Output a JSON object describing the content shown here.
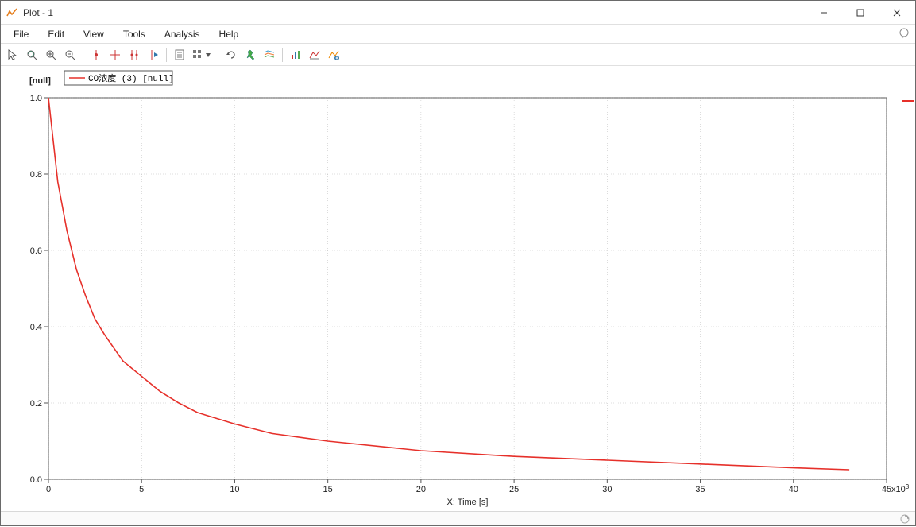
{
  "window": {
    "title": "Plot - 1"
  },
  "menu": {
    "items": [
      "File",
      "Edit",
      "View",
      "Tools",
      "Analysis",
      "Help"
    ]
  },
  "toolbar": {
    "buttons": [
      "arrow-cursor",
      "reset-zoom",
      "zoom-in",
      "zoom-out",
      "|",
      "single-marker",
      "cross-marker",
      "dual-marker",
      "play-marker",
      "|",
      "clipboard-list",
      "grid-dropdown",
      "|",
      "refresh",
      "pin",
      "layers",
      "|",
      "bar-chart",
      "line-chart",
      "add-chart"
    ]
  },
  "plot": {
    "y_label": "[null]",
    "x_label": "X: Time [s]",
    "x_exp_label": "x10",
    "x_exp_sup": "3",
    "legend": {
      "label": "CO浓度 (3) [null]",
      "color": "#e6302a"
    },
    "x_ticks": [
      0,
      5,
      10,
      15,
      20,
      25,
      30,
      35,
      40,
      45
    ],
    "y_ticks": [
      0.0,
      0.2,
      0.4,
      0.6,
      0.8,
      1.0
    ]
  },
  "chart_data": {
    "type": "line",
    "title": "",
    "xlabel": "X: Time [s]",
    "ylabel": "[null]",
    "x_unit_multiplier": 1000,
    "xlim": [
      0,
      45
    ],
    "ylim": [
      0.0,
      1.0
    ],
    "legend_position": "top-left",
    "grid": true,
    "series": [
      {
        "name": "CO浓度 (3) [null]",
        "color": "#e6302a",
        "x": [
          0,
          0.5,
          1,
          1.5,
          2,
          2.5,
          3,
          4,
          5,
          6,
          7,
          8,
          10,
          12,
          15,
          20,
          25,
          30,
          35,
          40,
          43
        ],
        "y": [
          1.0,
          0.78,
          0.65,
          0.55,
          0.48,
          0.42,
          0.38,
          0.31,
          0.27,
          0.23,
          0.2,
          0.175,
          0.145,
          0.12,
          0.1,
          0.075,
          0.06,
          0.05,
          0.04,
          0.03,
          0.025
        ]
      }
    ]
  }
}
